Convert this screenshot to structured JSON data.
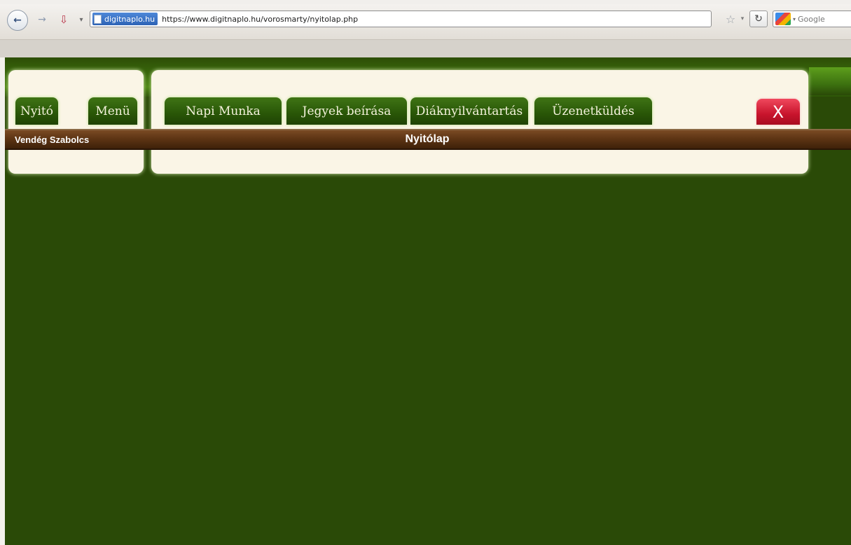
{
  "browser": {
    "site_identity": "digitnaplo.hu",
    "url": "https://www.digitnaplo.hu/vorosmarty/nyitolap.php",
    "search_placeholder": "Google",
    "icons": {
      "back": "back-arrow-icon",
      "forward": "forward-arrow-icon",
      "bookmark": "bookmark-icon",
      "page": "page-icon",
      "star": "star-icon",
      "reload": "reload-icon",
      "search_engine": "google-logo-icon"
    }
  },
  "app": {
    "tabs": [
      {
        "label": "Nyitó"
      },
      {
        "label": "Menü"
      },
      {
        "label": "Napi Munka"
      },
      {
        "label": "Jegyek beírása"
      },
      {
        "label": "Diáknyilvántartás"
      },
      {
        "label": "Üzenetküldés"
      }
    ],
    "close_label": "X",
    "user": "Vendég Szabolcs",
    "page_title": "Nyitólap"
  },
  "colors": {
    "background": "#2a4a07",
    "panel": "#faf5e6",
    "tab": "#295607",
    "close": "#c8142c",
    "titlebar": "#5e3514"
  }
}
